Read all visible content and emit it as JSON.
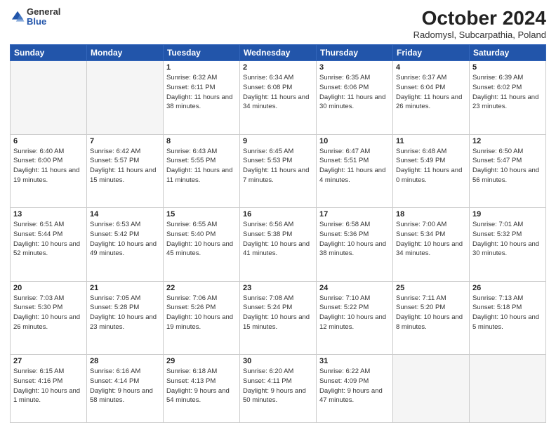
{
  "header": {
    "logo_general": "General",
    "logo_blue": "Blue",
    "month_title": "October 2024",
    "subtitle": "Radomysl, Subcarpathia, Poland"
  },
  "columns": [
    "Sunday",
    "Monday",
    "Tuesday",
    "Wednesday",
    "Thursday",
    "Friday",
    "Saturday"
  ],
  "weeks": [
    [
      {
        "num": "",
        "info": ""
      },
      {
        "num": "",
        "info": ""
      },
      {
        "num": "1",
        "info": "Sunrise: 6:32 AM\nSunset: 6:11 PM\nDaylight: 11 hours and 38 minutes."
      },
      {
        "num": "2",
        "info": "Sunrise: 6:34 AM\nSunset: 6:08 PM\nDaylight: 11 hours and 34 minutes."
      },
      {
        "num": "3",
        "info": "Sunrise: 6:35 AM\nSunset: 6:06 PM\nDaylight: 11 hours and 30 minutes."
      },
      {
        "num": "4",
        "info": "Sunrise: 6:37 AM\nSunset: 6:04 PM\nDaylight: 11 hours and 26 minutes."
      },
      {
        "num": "5",
        "info": "Sunrise: 6:39 AM\nSunset: 6:02 PM\nDaylight: 11 hours and 23 minutes."
      }
    ],
    [
      {
        "num": "6",
        "info": "Sunrise: 6:40 AM\nSunset: 6:00 PM\nDaylight: 11 hours and 19 minutes."
      },
      {
        "num": "7",
        "info": "Sunrise: 6:42 AM\nSunset: 5:57 PM\nDaylight: 11 hours and 15 minutes."
      },
      {
        "num": "8",
        "info": "Sunrise: 6:43 AM\nSunset: 5:55 PM\nDaylight: 11 hours and 11 minutes."
      },
      {
        "num": "9",
        "info": "Sunrise: 6:45 AM\nSunset: 5:53 PM\nDaylight: 11 hours and 7 minutes."
      },
      {
        "num": "10",
        "info": "Sunrise: 6:47 AM\nSunset: 5:51 PM\nDaylight: 11 hours and 4 minutes."
      },
      {
        "num": "11",
        "info": "Sunrise: 6:48 AM\nSunset: 5:49 PM\nDaylight: 11 hours and 0 minutes."
      },
      {
        "num": "12",
        "info": "Sunrise: 6:50 AM\nSunset: 5:47 PM\nDaylight: 10 hours and 56 minutes."
      }
    ],
    [
      {
        "num": "13",
        "info": "Sunrise: 6:51 AM\nSunset: 5:44 PM\nDaylight: 10 hours and 52 minutes."
      },
      {
        "num": "14",
        "info": "Sunrise: 6:53 AM\nSunset: 5:42 PM\nDaylight: 10 hours and 49 minutes."
      },
      {
        "num": "15",
        "info": "Sunrise: 6:55 AM\nSunset: 5:40 PM\nDaylight: 10 hours and 45 minutes."
      },
      {
        "num": "16",
        "info": "Sunrise: 6:56 AM\nSunset: 5:38 PM\nDaylight: 10 hours and 41 minutes."
      },
      {
        "num": "17",
        "info": "Sunrise: 6:58 AM\nSunset: 5:36 PM\nDaylight: 10 hours and 38 minutes."
      },
      {
        "num": "18",
        "info": "Sunrise: 7:00 AM\nSunset: 5:34 PM\nDaylight: 10 hours and 34 minutes."
      },
      {
        "num": "19",
        "info": "Sunrise: 7:01 AM\nSunset: 5:32 PM\nDaylight: 10 hours and 30 minutes."
      }
    ],
    [
      {
        "num": "20",
        "info": "Sunrise: 7:03 AM\nSunset: 5:30 PM\nDaylight: 10 hours and 26 minutes."
      },
      {
        "num": "21",
        "info": "Sunrise: 7:05 AM\nSunset: 5:28 PM\nDaylight: 10 hours and 23 minutes."
      },
      {
        "num": "22",
        "info": "Sunrise: 7:06 AM\nSunset: 5:26 PM\nDaylight: 10 hours and 19 minutes."
      },
      {
        "num": "23",
        "info": "Sunrise: 7:08 AM\nSunset: 5:24 PM\nDaylight: 10 hours and 15 minutes."
      },
      {
        "num": "24",
        "info": "Sunrise: 7:10 AM\nSunset: 5:22 PM\nDaylight: 10 hours and 12 minutes."
      },
      {
        "num": "25",
        "info": "Sunrise: 7:11 AM\nSunset: 5:20 PM\nDaylight: 10 hours and 8 minutes."
      },
      {
        "num": "26",
        "info": "Sunrise: 7:13 AM\nSunset: 5:18 PM\nDaylight: 10 hours and 5 minutes."
      }
    ],
    [
      {
        "num": "27",
        "info": "Sunrise: 6:15 AM\nSunset: 4:16 PM\nDaylight: 10 hours and 1 minute."
      },
      {
        "num": "28",
        "info": "Sunrise: 6:16 AM\nSunset: 4:14 PM\nDaylight: 9 hours and 58 minutes."
      },
      {
        "num": "29",
        "info": "Sunrise: 6:18 AM\nSunset: 4:13 PM\nDaylight: 9 hours and 54 minutes."
      },
      {
        "num": "30",
        "info": "Sunrise: 6:20 AM\nSunset: 4:11 PM\nDaylight: 9 hours and 50 minutes."
      },
      {
        "num": "31",
        "info": "Sunrise: 6:22 AM\nSunset: 4:09 PM\nDaylight: 9 hours and 47 minutes."
      },
      {
        "num": "",
        "info": ""
      },
      {
        "num": "",
        "info": ""
      }
    ]
  ]
}
